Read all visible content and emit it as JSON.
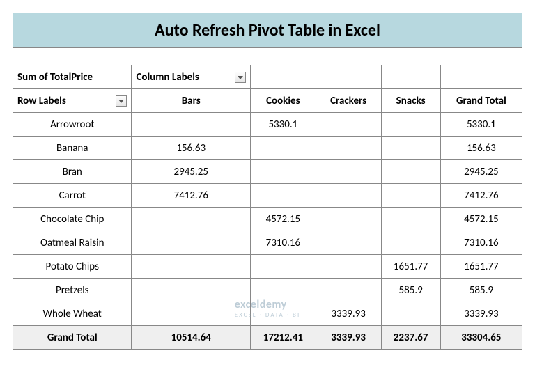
{
  "title": "Auto Refresh Pivot Table in Excel",
  "pivot": {
    "measure": "Sum of TotalPrice",
    "columnLabelsHeader": "Column Labels",
    "rowLabelsHeader": "Row Labels",
    "columns": [
      "Bars",
      "Cookies",
      "Crackers",
      "Snacks",
      "Grand Total"
    ],
    "rows": [
      {
        "label": "Arrowroot",
        "values": [
          "",
          "5330.1",
          "",
          "",
          "5330.1"
        ]
      },
      {
        "label": "Banana",
        "values": [
          "156.63",
          "",
          "",
          "",
          "156.63"
        ]
      },
      {
        "label": "Bran",
        "values": [
          "2945.25",
          "",
          "",
          "",
          "2945.25"
        ]
      },
      {
        "label": "Carrot",
        "values": [
          "7412.76",
          "",
          "",
          "",
          "7412.76"
        ]
      },
      {
        "label": "Chocolate Chip",
        "values": [
          "",
          "4572.15",
          "",
          "",
          "4572.15"
        ]
      },
      {
        "label": "Oatmeal Raisin",
        "values": [
          "",
          "7310.16",
          "",
          "",
          "7310.16"
        ]
      },
      {
        "label": "Potato Chips",
        "values": [
          "",
          "",
          "",
          "1651.77",
          "1651.77"
        ]
      },
      {
        "label": "Pretzels",
        "values": [
          "",
          "",
          "",
          "585.9",
          "585.9"
        ]
      },
      {
        "label": "Whole Wheat",
        "values": [
          "",
          "",
          "3339.93",
          "",
          "3339.93"
        ]
      }
    ],
    "grandTotal": {
      "label": "Grand Total",
      "values": [
        "10514.64",
        "17212.41",
        "3339.93",
        "2237.67",
        "33304.65"
      ]
    }
  },
  "watermark": {
    "main": "exceldemy",
    "sub": "EXCEL · DATA · BI"
  },
  "chart_data": {
    "type": "table",
    "title": "Sum of TotalPrice by Row Labels and Column Labels",
    "columns": [
      "Bars",
      "Cookies",
      "Crackers",
      "Snacks",
      "Grand Total"
    ],
    "rows": [
      "Arrowroot",
      "Banana",
      "Bran",
      "Carrot",
      "Chocolate Chip",
      "Oatmeal Raisin",
      "Potato Chips",
      "Pretzels",
      "Whole Wheat",
      "Grand Total"
    ],
    "values": [
      [
        null,
        5330.1,
        null,
        null,
        5330.1
      ],
      [
        156.63,
        null,
        null,
        null,
        156.63
      ],
      [
        2945.25,
        null,
        null,
        null,
        2945.25
      ],
      [
        7412.76,
        null,
        null,
        null,
        7412.76
      ],
      [
        null,
        4572.15,
        null,
        null,
        4572.15
      ],
      [
        null,
        7310.16,
        null,
        null,
        7310.16
      ],
      [
        null,
        null,
        null,
        1651.77,
        1651.77
      ],
      [
        null,
        null,
        null,
        585.9,
        585.9
      ],
      [
        null,
        null,
        3339.93,
        null,
        3339.93
      ],
      [
        10514.64,
        17212.41,
        3339.93,
        2237.67,
        33304.65
      ]
    ]
  }
}
